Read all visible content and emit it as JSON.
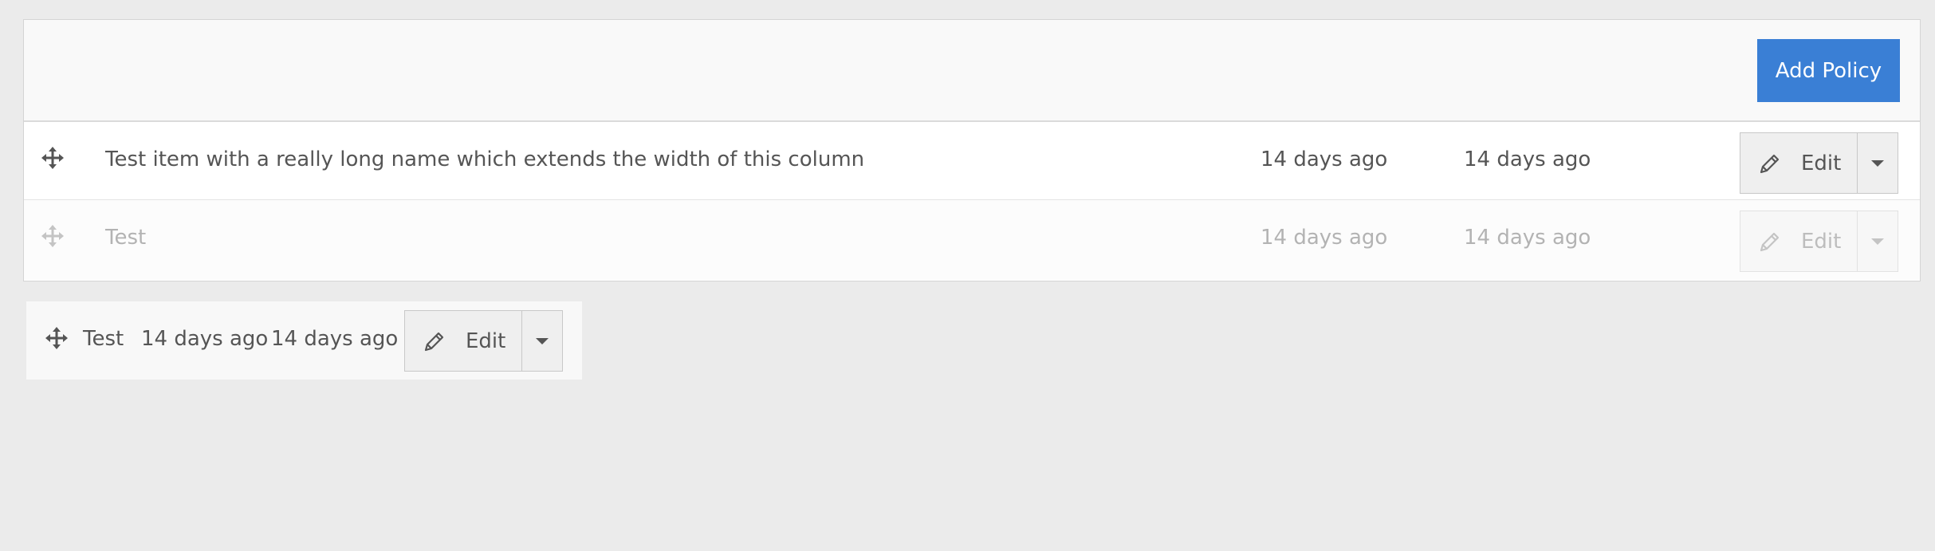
{
  "header": {
    "add_button_label": "Add Policy"
  },
  "rows": [
    {
      "name": "Test item with a really long name which extends the width of this column",
      "created": "14 days ago",
      "updated": "14 days ago",
      "edit_label": "Edit",
      "disabled": false
    },
    {
      "name": "Test",
      "created": "14 days ago",
      "updated": "14 days ago",
      "edit_label": "Edit",
      "disabled": true
    }
  ],
  "drag_preview": {
    "name": "Test",
    "created": "14 days ago",
    "updated": "14 days ago",
    "edit_label": "Edit"
  },
  "icons": {
    "move": "move-arrows-icon",
    "edit": "pencil-icon",
    "dropdown": "caret-down-icon"
  },
  "colors": {
    "accent": "#3a7fd5",
    "background": "#ebebeb"
  }
}
